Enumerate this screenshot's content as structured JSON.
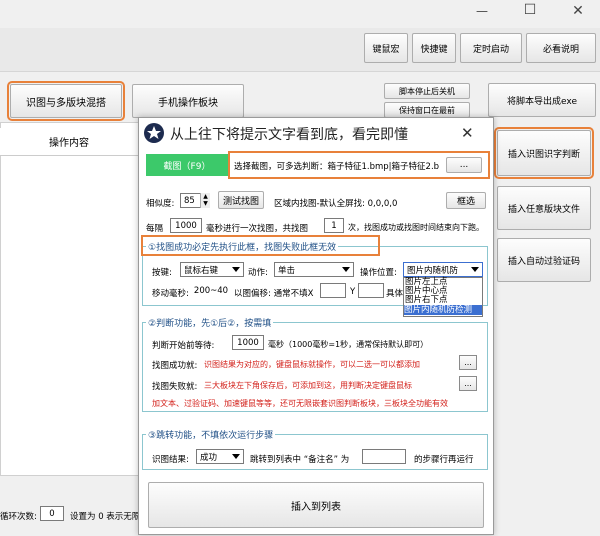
{
  "window": {
    "controls": {
      "minimize": "—",
      "maximize": "☐",
      "close": "✕"
    },
    "toolbar": [
      "键鼠宏",
      "快捷键",
      "定时启动",
      "必看说明"
    ],
    "tabs": {
      "active": "识图与多版块混搭",
      "other": "手机操作板块"
    },
    "small_buttons": [
      "脚本停止后关机",
      "保持窗口在最前"
    ],
    "export_button": "将脚本导出成exe",
    "column_header": "操作内容",
    "side_buttons": [
      "插入识图识字判断",
      "插入任意版块文件",
      "插入自动过验证码"
    ],
    "footer": {
      "loop_label": "循环次数:",
      "loop_value": "0",
      "loop_hint": "设置为 0 表示无限"
    }
  },
  "dialog": {
    "title": "从上往下将提示文字看到底，看完即懂",
    "close": "✕",
    "screenshot_button": "截图（F9）",
    "screenshot_hint": "选择截图，可多选判断：箱子特征1.bmp|箱子特征2.b",
    "ellipsis": "...",
    "similarity_label": "相似度:",
    "similarity_value": "85",
    "test_button": "测试找图",
    "region_label": "区域内找图-默认全屏找: 0,0,0,0",
    "select_button": "框选",
    "interval_prefix": "每隔",
    "interval_value": "1000",
    "interval_mid": "毫秒进行一次找图，共找图",
    "count_value": "1",
    "interval_suffix": "次，找图成功或找图时间结束向下跑。",
    "group1": {
      "title": "①找图成功必定先执行此框，找图失败此框无效",
      "key_label": "按键:",
      "key_value": "鼠标右键",
      "action_label": "动作:",
      "action_value": "单击",
      "position_label": "操作位置:",
      "position_value": "图片内随机防",
      "position_options": [
        "图片左上点",
        "图片中心点",
        "图片右下点",
        "图片内随机防检测"
      ],
      "move_label": "移动毫秒:",
      "move_value": "200~40",
      "offset_label": "以图偏移: 通常不填X",
      "y_label": "Y",
      "specific_label": "具体"
    },
    "group2": {
      "title": "②判断功能，先①后②，按需填",
      "wait_label": "判断开始前等待:",
      "wait_value": "1000",
      "wait_hint": "毫秒（1000毫秒=1秒，通常保持默认即可）",
      "success_label": "找图成功就:",
      "success_hint": "识图结果为对应的，键盘鼠标就操作，可以二选一可以都添加",
      "fail_label": "找图失败就:",
      "fail_hint": "三大板块左下角保存后，可添加到这，用判断决定键盘鼠标",
      "note": "加文本、过验证码、加速键鼠等等，还可无限嵌套识图判断板块，三板块全功能有效"
    },
    "group3": {
      "title": "③跳转功能，不填依次运行步骤",
      "result_label": "识图结果:",
      "result_value": "成功",
      "jump_label": "跳转到列表中 “备注名” 为",
      "jump_suffix": "的步骤行再运行"
    },
    "insert_button": "插入到列表"
  },
  "colors": {
    "highlight": "#e8813a",
    "green": "#3cc96a",
    "red_text": "#d3211b",
    "group_title": "#1f4f86"
  }
}
